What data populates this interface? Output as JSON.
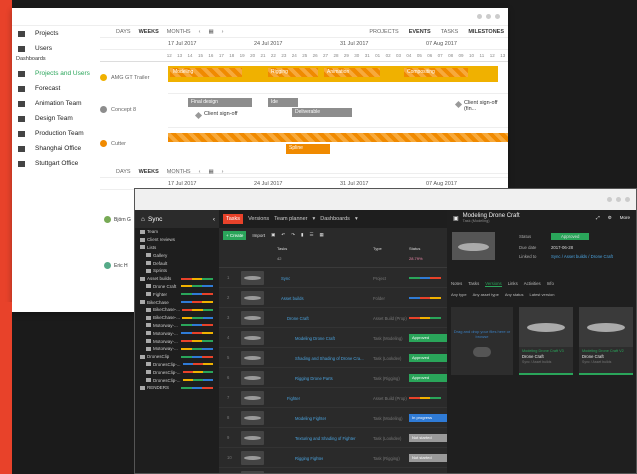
{
  "planner": {
    "sidebar": [
      {
        "label": "Projects",
        "icon": "folder-icon"
      },
      {
        "label": "Users",
        "icon": "user-icon"
      },
      {
        "section": "Dashboards"
      },
      {
        "label": "Projects and Users",
        "icon": "sliders-icon",
        "active": true
      },
      {
        "label": "Forecast",
        "icon": "chart-icon"
      },
      {
        "label": "Animation Team",
        "icon": "grid-icon"
      },
      {
        "label": "Design Team",
        "icon": "grid-icon"
      },
      {
        "label": "Production Team",
        "icon": "grid-icon"
      },
      {
        "label": "Shanghai Office",
        "icon": "grid-icon"
      },
      {
        "label": "Stuttgart Office",
        "icon": "grid-icon"
      }
    ],
    "zoom": [
      "DAYS",
      "WEEKS",
      "MONTHS"
    ],
    "view_tabs": [
      "PROJECTS",
      "EVENTS",
      "TASKS",
      "MILESTONES"
    ],
    "months": [
      "17 Jul 2017",
      "24 Jul 2017",
      "31 Jul 2017",
      "07 Aug 2017"
    ],
    "days": [
      "12",
      "13",
      "14",
      "15",
      "16",
      "17",
      "18",
      "19",
      "20",
      "21",
      "22",
      "23",
      "24",
      "25",
      "26",
      "27",
      "28",
      "29",
      "30",
      "31",
      "01",
      "02",
      "03",
      "04",
      "05",
      "06",
      "07",
      "08",
      "09",
      "10",
      "11",
      "12",
      "13"
    ],
    "rows": [
      {
        "name": "AMG GT Trailer",
        "color": "#f0b100"
      },
      {
        "name": "Concept 8",
        "color": "#8d8d8d"
      },
      {
        "name": "Cutter",
        "color": "#f08a00"
      }
    ],
    "bars": {
      "modeling": "Modeling",
      "rigging": "Rigging",
      "animation": "Animation",
      "compositing": "Compositing",
      "final_design": "Final design",
      "ide": "Ide",
      "deliverable": "Deliverable",
      "sign_off": "Client sign-off",
      "sign_off2": "Client sign-off (fin...",
      "spline": "Spline"
    },
    "second": {
      "months": [
        "17 Jul 2017",
        "24 Jul 2017",
        "31 Jul 2017",
        "07 Aug 2017"
      ],
      "users": [
        "Björn G",
        "Eric H"
      ]
    }
  },
  "tracker": {
    "project": "Sync",
    "tree": [
      {
        "label": "Team",
        "d": 0
      },
      {
        "label": "Client reviews",
        "d": 0
      },
      {
        "label": "Lists",
        "d": 0
      },
      {
        "label": "Gallery",
        "d": 1
      },
      {
        "label": "Default",
        "d": 1
      },
      {
        "label": "Sprints",
        "d": 1
      },
      {
        "label": "Asset builds",
        "d": 0
      },
      {
        "label": "Drone Craft",
        "d": 1
      },
      {
        "label": "Fighter",
        "d": 1
      },
      {
        "label": "BikeChase",
        "d": 0
      },
      {
        "label": "BikeChase-...",
        "d": 1
      },
      {
        "label": "BikeChase-...",
        "d": 1
      },
      {
        "label": "Motorway-...",
        "d": 1
      },
      {
        "label": "Motorway-...",
        "d": 1
      },
      {
        "label": "Motorway-...",
        "d": 1
      },
      {
        "label": "Motorway-...",
        "d": 1
      },
      {
        "label": "DronesClip",
        "d": 0
      },
      {
        "label": "DronesClip-...",
        "d": 1
      },
      {
        "label": "DronesClip-...",
        "d": 1
      },
      {
        "label": "DronesClip-...",
        "d": 1
      },
      {
        "label": "RENDERS",
        "d": 0
      }
    ],
    "nav": [
      "Tasks",
      "Versions",
      "Team planner",
      "Dashboards"
    ],
    "tools": {
      "create": "+ Create",
      "import": "Import"
    },
    "cols": {
      "tasks": "Tasks",
      "type": "Type",
      "status": "Status",
      "count": "42",
      "pct": "28.79%"
    },
    "rows": [
      {
        "n": "1",
        "name": "Sync",
        "type": "Project",
        "status": "",
        "color": ""
      },
      {
        "n": "2",
        "name": "Asset builds",
        "type": "Folder",
        "status": "",
        "color": ""
      },
      {
        "n": "3",
        "name": "Drone Craft",
        "type": "Asset Build (Prop)",
        "status": "",
        "color": ""
      },
      {
        "n": "4",
        "name": "Modeling Drone Craft",
        "type": "Task (Modeling)",
        "status": "Approved",
        "color": "#2aa55a"
      },
      {
        "n": "5",
        "name": "Shading and Shading of Drone Cra...",
        "type": "Task (Lookdev)",
        "status": "Approved",
        "color": "#2aa55a"
      },
      {
        "n": "6",
        "name": "Rigging Drone Parts",
        "type": "Task (Rigging)",
        "status": "Approved",
        "color": "#2aa55a"
      },
      {
        "n": "7",
        "name": "Fighter",
        "type": "Asset Build (Prop)",
        "status": "",
        "color": ""
      },
      {
        "n": "8",
        "name": "Modeling Fighter",
        "type": "Task (Modeling)",
        "status": "In progress",
        "color": "#2f7bd6"
      },
      {
        "n": "9",
        "name": "Texturing and Shading of Fighter",
        "type": "Task (Lookdev)",
        "status": "Not started",
        "color": "#9a9a9a"
      },
      {
        "n": "10",
        "name": "Rigging Fighter",
        "type": "Task (Rigging)",
        "status": "Not started",
        "color": "#9a9a9a"
      },
      {
        "n": "11",
        "name": "BikeChase",
        "type": "Sequence",
        "status": "",
        "color": ""
      }
    ],
    "detail": {
      "title": "Modeling Drone Craft",
      "subtitle": "Task (Modeling)",
      "status_label": "Status",
      "status": "Approved",
      "due_label": "Due date",
      "due": "2017-06-28",
      "linked_label": "Linked to",
      "linked": "Sync / Asset builds / Drone Craft",
      "tabs": [
        "Notes",
        "Tasks",
        "Versions",
        "Links",
        "Activities",
        "Info"
      ],
      "filters": [
        "Any type",
        "Any asset type",
        "Any status",
        "Latest version"
      ],
      "drop": "Drag and drop your files here or browse",
      "more": "More",
      "cards": [
        {
          "title": "Modeling Drone Craft V3",
          "name": "Drone Craft",
          "path": "Sync / Asset builds"
        },
        {
          "title": "Modeling Drone Craft V2",
          "name": "Drone Craft",
          "path": "Sync / Asset builds"
        }
      ]
    }
  }
}
